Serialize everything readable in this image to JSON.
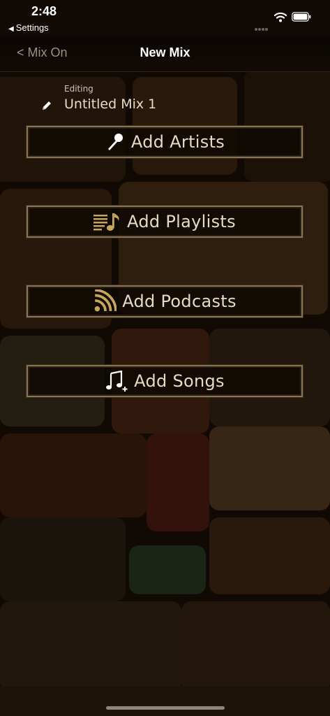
{
  "status_bar": {
    "time": "2:48",
    "back_app": "Settings",
    "icons": [
      "signal-dots",
      "wifi-icon",
      "battery-icon"
    ]
  },
  "nav": {
    "back_label": "< Mix On",
    "title": "New Mix"
  },
  "editor": {
    "editing_label": "Editing",
    "mix_name": "Untitled Mix 1",
    "icon": "pencil-icon"
  },
  "actions": [
    {
      "label": "Add Artists",
      "icon": "microphone-icon"
    },
    {
      "label": "Add Playlists",
      "icon": "playlist-icon"
    },
    {
      "label": "Add Podcasts",
      "icon": "podcast-icon"
    },
    {
      "label": "Add Songs",
      "icon": "add-song-icon"
    }
  ],
  "colors": {
    "background": "#140d06",
    "button_border": "#8a7456",
    "gold_icon": "#c9a55a",
    "text": "#e6dac4"
  }
}
